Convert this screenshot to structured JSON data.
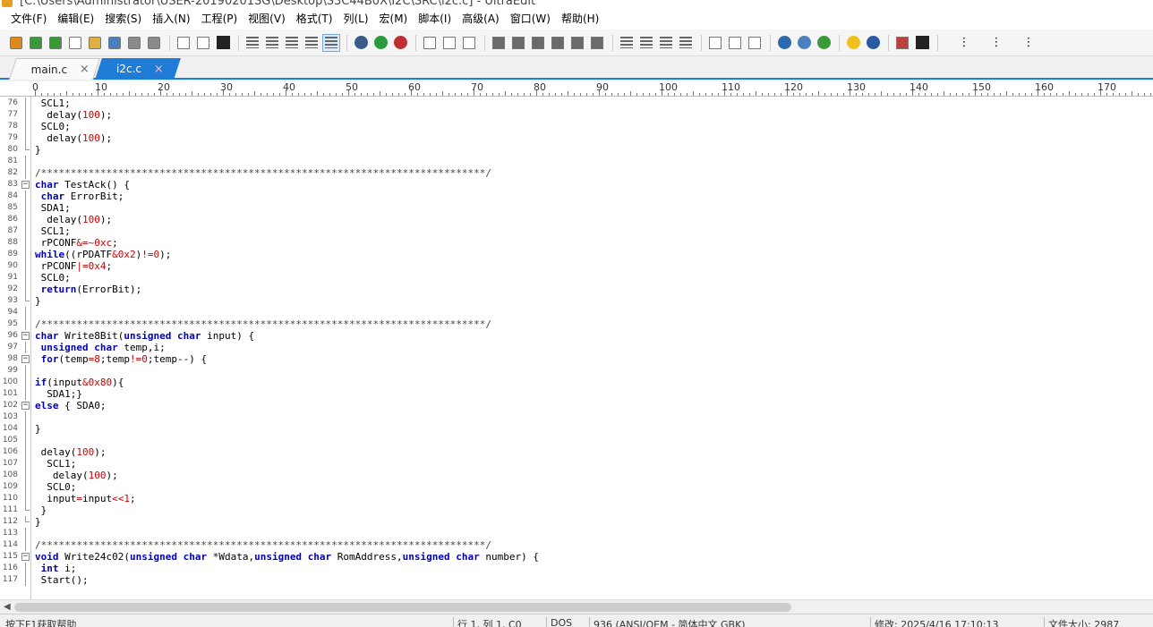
{
  "window": {
    "title": "[C:\\Users\\Administrator\\USER-20190201SG\\Desktop\\S3C44B0X\\I2C\\SRC\\i2c.c] - UltraEdit"
  },
  "menu": [
    "文件(F)",
    "编辑(E)",
    "搜索(S)",
    "插入(N)",
    "工程(P)",
    "视图(V)",
    "格式(T)",
    "列(L)",
    "宏(M)",
    "脚本(I)",
    "高级(A)",
    "窗口(W)",
    "帮助(H)"
  ],
  "toolbar": {
    "groups": [
      [
        "open-folder-icon",
        "back-arrow-icon",
        "forward-arrow-icon",
        "new-file-icon",
        "open-file-icon",
        "open-project-icon",
        "save-icon",
        "save-all-icon"
      ],
      [
        "print-icon",
        "print-preview-icon",
        "font-icon"
      ],
      [
        "word-wrap-icon",
        "line-numbers-icon",
        "column-mode-icon",
        "hex-mode-icon",
        "page-view-icon"
      ],
      [
        "record-macro-icon",
        "play-macro-icon",
        "stop-macro-icon"
      ],
      [
        "cut-icon",
        "copy-icon",
        "paste-icon"
      ],
      [
        "find-icon",
        "find-next-icon",
        "replace-icon",
        "find-in-files-icon",
        "bookmark-icon",
        "goto-icon"
      ],
      [
        "align-left-icon",
        "align-center-icon",
        "align-right-icon",
        "justify-icon"
      ],
      [
        "split-horizontal-icon",
        "split-vertical-icon",
        "cascade-icon"
      ],
      [
        "browser-icon",
        "ftp-icon",
        "refresh-icon"
      ],
      [
        "tip-icon",
        "help-icon"
      ],
      [
        "list-icon",
        "bold-icon"
      ]
    ]
  },
  "tabs": [
    {
      "label": "main.c",
      "close": "×",
      "active": false
    },
    {
      "label": "i2c.c",
      "close": "×",
      "active": true
    }
  ],
  "ruler": {
    "labels": [
      "0",
      "10",
      "20",
      "30",
      "40",
      "50",
      "60",
      "70",
      "80",
      "90",
      "100",
      "110",
      "120",
      "130",
      "140",
      "150",
      "160",
      "170"
    ]
  },
  "code": {
    "lines": [
      {
        "n": "76",
        "t": " SCL1;"
      },
      {
        "n": "77",
        "t": "  delay(100);"
      },
      {
        "n": "78",
        "t": " SCL0;"
      },
      {
        "n": "79",
        "t": "  delay(100);"
      },
      {
        "n": "80",
        "t": "}"
      },
      {
        "n": "81",
        "t": ""
      },
      {
        "n": "82",
        "t": "/***************************************************************************/"
      },
      {
        "n": "83",
        "t": "char TestAck() {"
      },
      {
        "n": "84",
        "t": " char ErrorBit;"
      },
      {
        "n": "85",
        "t": " SDA1;"
      },
      {
        "n": "86",
        "t": "  delay(100);"
      },
      {
        "n": "87",
        "t": " SCL1;"
      },
      {
        "n": "88",
        "t": " rPCONF&=~0xc;"
      },
      {
        "n": "89",
        "t": "while((rPDATF&0x2)!=0);"
      },
      {
        "n": "90",
        "t": " rPCONF|=0x4;"
      },
      {
        "n": "91",
        "t": " SCL0;"
      },
      {
        "n": "92",
        "t": " return(ErrorBit);"
      },
      {
        "n": "93",
        "t": "}"
      },
      {
        "n": "94",
        "t": ""
      },
      {
        "n": "95",
        "t": "/***************************************************************************/"
      },
      {
        "n": "96",
        "t": "char Write8Bit(unsigned char input) {"
      },
      {
        "n": "97",
        "t": " unsigned char temp,i;"
      },
      {
        "n": "98",
        "t": " for(temp=8;temp!=0;temp--) {"
      },
      {
        "n": "99",
        "t": ""
      },
      {
        "n": "100",
        "t": "if(input&0x80){"
      },
      {
        "n": "101",
        "t": "  SDA1;}"
      },
      {
        "n": "102",
        "t": "else { SDA0;"
      },
      {
        "n": "103",
        "t": ""
      },
      {
        "n": "104",
        "t": "}"
      },
      {
        "n": "105",
        "t": ""
      },
      {
        "n": "106",
        "t": " delay(100);"
      },
      {
        "n": "107",
        "t": "  SCL1;"
      },
      {
        "n": "108",
        "t": "   delay(100);"
      },
      {
        "n": "109",
        "t": "  SCL0;"
      },
      {
        "n": "110",
        "t": "  input=input<<1;"
      },
      {
        "n": "111",
        "t": " }"
      },
      {
        "n": "112",
        "t": "}"
      },
      {
        "n": "113",
        "t": ""
      },
      {
        "n": "114",
        "t": "/***************************************************************************/"
      },
      {
        "n": "115",
        "t": "void Write24c02(unsigned char *Wdata,unsigned char RomAddress,unsigned char number) {"
      },
      {
        "n": "116",
        "t": " int i;"
      },
      {
        "n": "117",
        "t": " Start();"
      }
    ]
  },
  "status": [
    "按下F1获取帮助",
    "行 1, 列 1, C0",
    "DOS",
    "936 (ANSI/OEM - 简体中文 GBK)",
    "修改: 2025/4/16 17:10:13",
    "文件大小: 2987"
  ]
}
